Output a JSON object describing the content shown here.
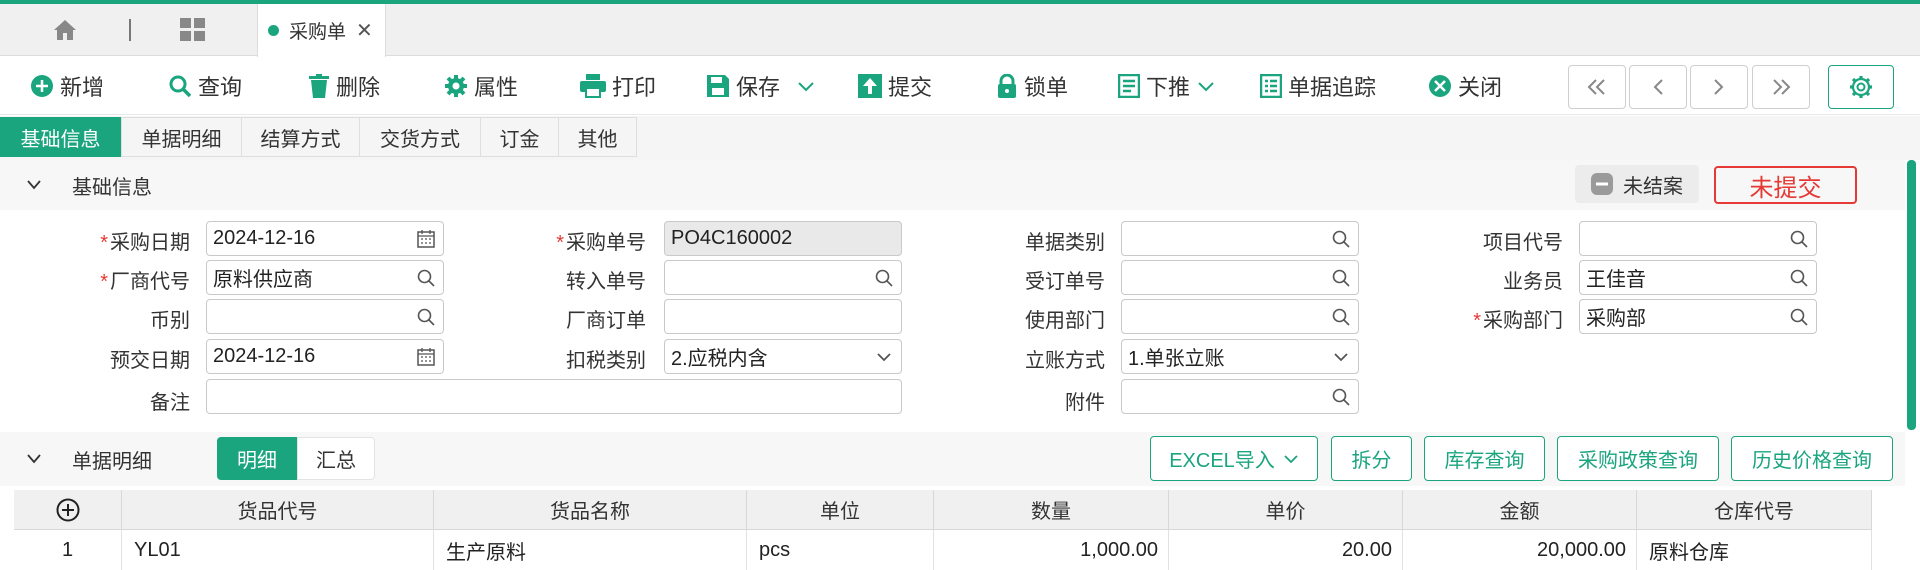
{
  "tabs": {
    "doc_tab_label": "采购单"
  },
  "toolbar": {
    "add": "新增",
    "query": "查询",
    "delete": "删除",
    "properties": "属性",
    "print": "打印",
    "save": "保存",
    "submit": "提交",
    "lock": "锁单",
    "push_down": "下推",
    "trace": "单据追踪",
    "close": "关闭"
  },
  "section_tabs": [
    "基础信息",
    "单据明细",
    "结算方式",
    "交货方式",
    "订金",
    "其他"
  ],
  "basic_panel": {
    "title": "基础信息",
    "status_unclosed": "未结案",
    "status_unsubmitted": "未提交"
  },
  "form": {
    "purchase_date": {
      "label": "采购日期",
      "value": "2024-12-16"
    },
    "vendor_code": {
      "label": "厂商代号",
      "value": "原料供应商"
    },
    "currency": {
      "label": "币别",
      "value": ""
    },
    "expected_date": {
      "label": "预交日期",
      "value": "2024-12-16"
    },
    "remark": {
      "label": "备注",
      "value": ""
    },
    "purchase_no": {
      "label": "采购单号",
      "value": "PO4C160002"
    },
    "transfer_no": {
      "label": "转入单号",
      "value": ""
    },
    "vendor_order": {
      "label": "厂商订单",
      "value": ""
    },
    "tax_type": {
      "label": "扣税类别",
      "value": "2.应税内含"
    },
    "doc_type": {
      "label": "单据类别",
      "value": ""
    },
    "sales_order_no": {
      "label": "受订单号",
      "value": ""
    },
    "use_dept": {
      "label": "使用部门",
      "value": ""
    },
    "account_method": {
      "label": "立账方式",
      "value": "1.单张立账"
    },
    "attachment": {
      "label": "附件",
      "value": ""
    },
    "project_code": {
      "label": "项目代号",
      "value": ""
    },
    "salesman": {
      "label": "业务员",
      "value": "王佳音"
    },
    "purchase_dept": {
      "label": "采购部门",
      "value": "采购部"
    }
  },
  "detail_panel": {
    "title": "单据明细",
    "seg_detail": "明细",
    "seg_summary": "汇总",
    "excel_import": "EXCEL导入",
    "split": "拆分",
    "stock_query": "库存查询",
    "policy_query": "采购政策查询",
    "price_history": "历史价格查询"
  },
  "table": {
    "headers": [
      "货品代号",
      "货品名称",
      "单位",
      "数量",
      "单价",
      "金额",
      "仓库代号"
    ],
    "rows": [
      {
        "no": "1",
        "item_code": "YL01",
        "item_name": "生产原料",
        "unit": "pcs",
        "qty": "1,000.00",
        "price": "20.00",
        "amount": "20,000.00",
        "warehouse": "原料仓库"
      }
    ]
  },
  "colors": {
    "accent": "#1aa57f",
    "danger": "#e53935"
  }
}
